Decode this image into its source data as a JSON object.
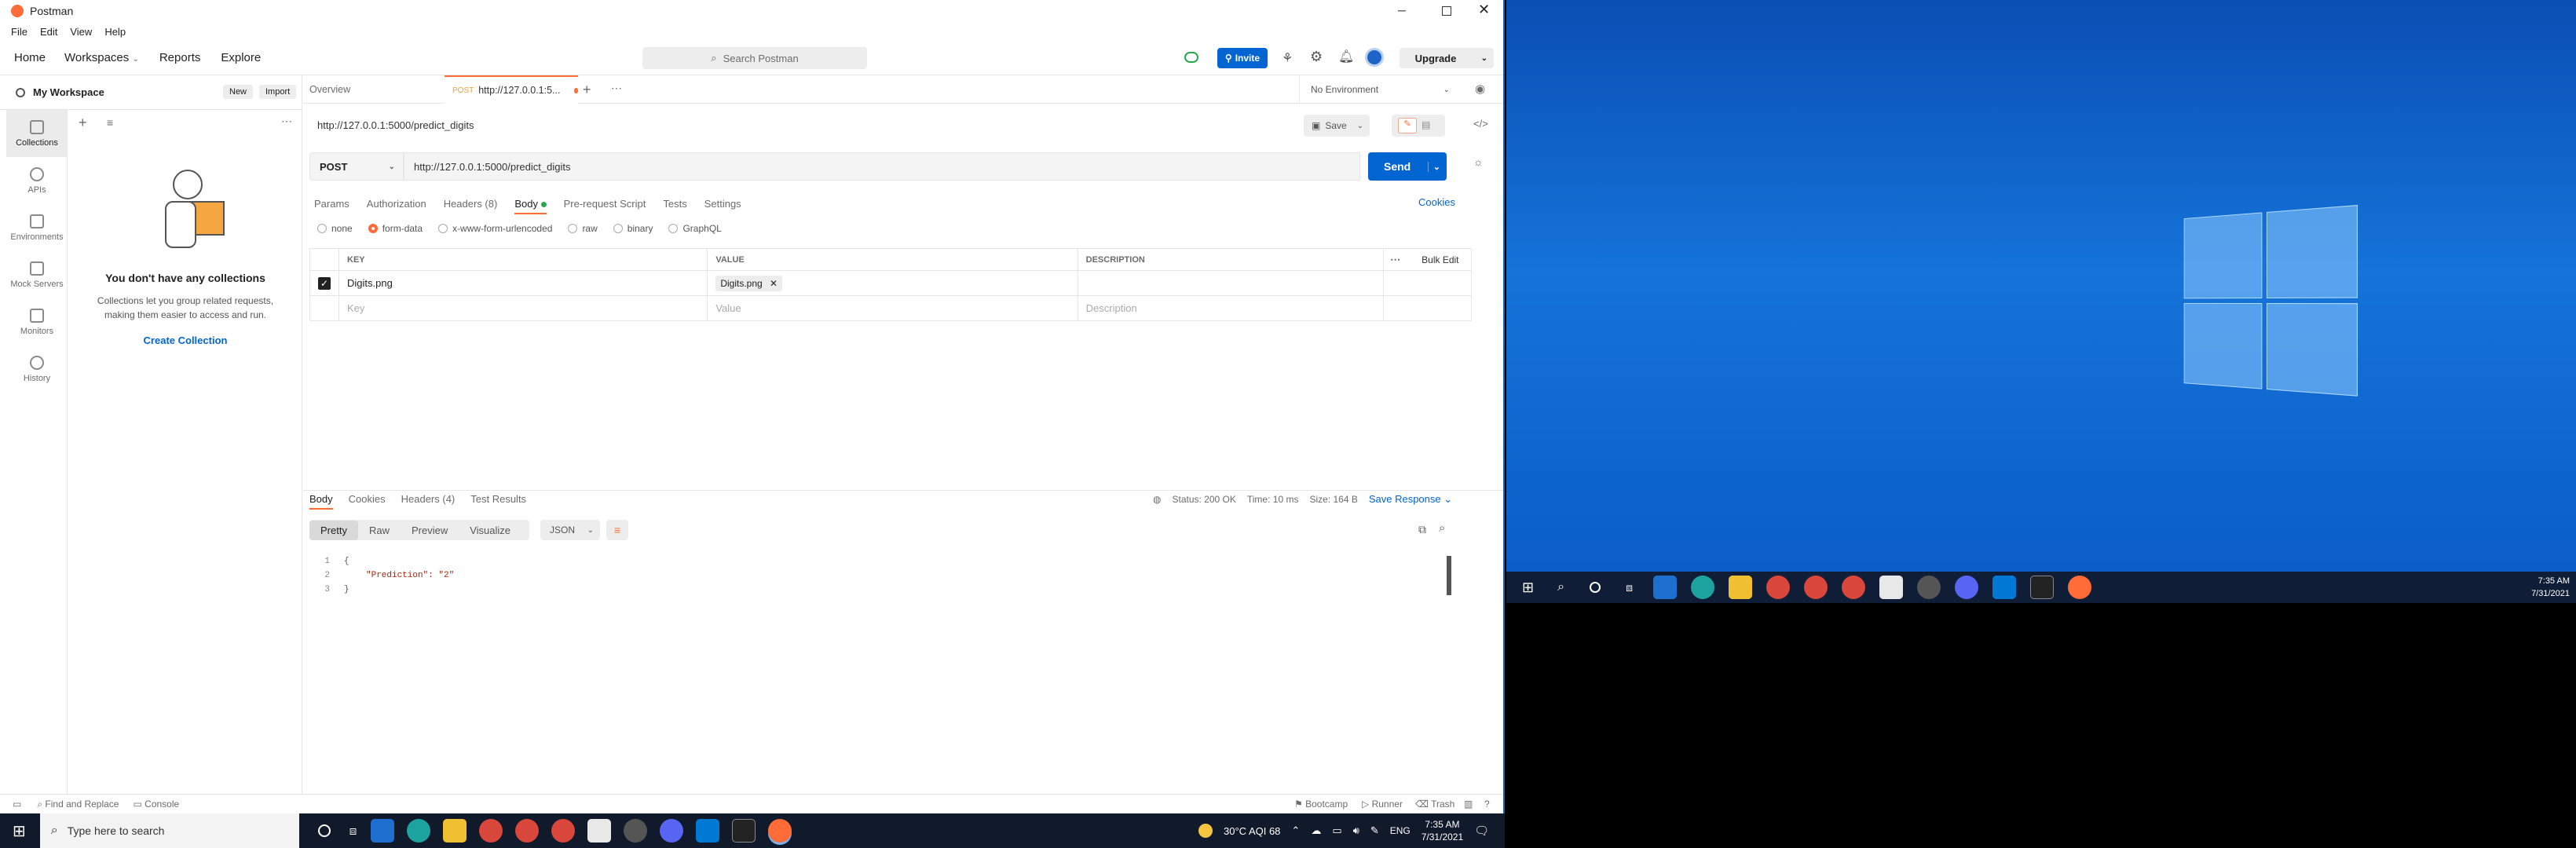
{
  "app": {
    "title": "Postman"
  },
  "menu": [
    "File",
    "Edit",
    "View",
    "Help"
  ],
  "header": {
    "home": "Home",
    "workspaces": "Workspaces",
    "reports": "Reports",
    "explore": "Explore",
    "search_placeholder": "Search Postman",
    "invite": "Invite",
    "upgrade": "Upgrade"
  },
  "workspace": {
    "name": "My Workspace",
    "new_label": "New",
    "import_label": "Import",
    "empty_title": "You don't have any collections",
    "empty_text_1": "Collections let you group related requests,",
    "empty_text_2": "making them easier to access and run.",
    "create_link": "Create Collection"
  },
  "rail": [
    {
      "label": "Collections"
    },
    {
      "label": "APIs"
    },
    {
      "label": "Environments"
    },
    {
      "label": "Mock Servers"
    },
    {
      "label": "Monitors"
    },
    {
      "label": "History"
    }
  ],
  "tabs": {
    "overview": "Overview",
    "request_method": "POST",
    "request_label": "http://127.0.0.1:5...",
    "environment": "No Environment"
  },
  "request": {
    "title": "http://127.0.0.1:5000/predict_digits",
    "save": "Save",
    "method": "POST",
    "url": "http://127.0.0.1:5000/predict_digits",
    "send": "Send"
  },
  "params_tabs": {
    "params": "Params",
    "authorization": "Authorization",
    "headers": "Headers (8)",
    "body": "Body",
    "pre_request": "Pre-request Script",
    "tests": "Tests",
    "settings": "Settings",
    "cookies": "Cookies"
  },
  "body_types": [
    "none",
    "form-data",
    "x-www-form-urlencoded",
    "raw",
    "binary",
    "GraphQL"
  ],
  "form_table": {
    "headers": [
      "KEY",
      "VALUE",
      "DESCRIPTION"
    ],
    "bulk_edit": "Bulk Edit",
    "rows": [
      {
        "key": "Digits.png",
        "value": "Digits.png"
      }
    ],
    "placeholder_key": "Key",
    "placeholder_value": "Value",
    "placeholder_description": "Description"
  },
  "response": {
    "tabs": [
      "Body",
      "Cookies",
      "Headers (4)",
      "Test Results"
    ],
    "status": "Status: 200 OK",
    "time": "Time: 10 ms",
    "size": "Size: 164 B",
    "save_response": "Save Response",
    "view_modes": [
      "Pretty",
      "Raw",
      "Preview",
      "Visualize"
    ],
    "format": "JSON",
    "lines": [
      {
        "num": "1",
        "text": "{"
      },
      {
        "num": "2",
        "text": "\"Prediction\": \"2\""
      },
      {
        "num": "3",
        "text": "}"
      }
    ]
  },
  "statusbar": {
    "find_replace": "Find and Replace",
    "console": "Console",
    "bootcamp": "Bootcamp",
    "runner": "Runner",
    "trash": "Trash"
  },
  "taskbar": {
    "search_placeholder": "Type here to search",
    "weather": "30°C AQI 68",
    "lang": "ENG",
    "time": "7:35 AM",
    "date": "7/31/2021"
  },
  "desktop_clock": {
    "time": "7:35 AM",
    "date": "7/31/2021"
  },
  "colors": {
    "accent": "#ff6c37",
    "send_blue": "#0265d2",
    "desktop_blue": "#0a5bc7"
  }
}
